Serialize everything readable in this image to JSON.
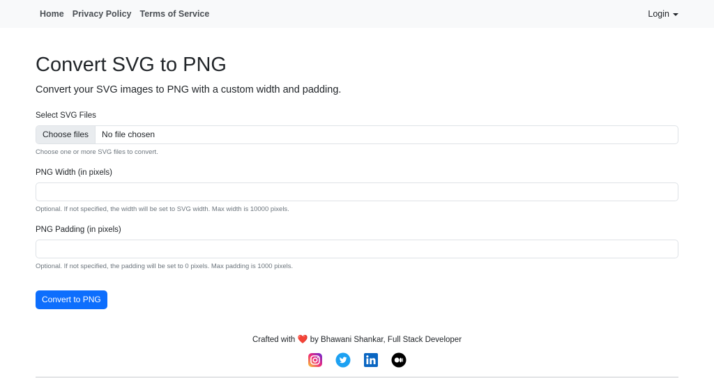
{
  "nav": {
    "links": [
      "Home",
      "Privacy Policy",
      "Terms of Service"
    ],
    "login": "Login"
  },
  "page": {
    "title": "Convert SVG to PNG",
    "lead": "Convert your SVG images to PNG with a custom width and padding."
  },
  "form": {
    "files_label": "Select SVG Files",
    "files_button": "Choose files",
    "files_status": "No file chosen",
    "files_help": "Choose one or more SVG files to convert.",
    "width_label": "PNG Width (in pixels)",
    "width_value": "",
    "width_help": "Optional. If not specified, the width will be set to SVG width. Max width is 10000 pixels.",
    "padding_label": "PNG Padding (in pixels)",
    "padding_value": "",
    "padding_help": "Optional. If not specified, the padding will be set to 0 pixels. Max padding is 1000 pixels.",
    "submit": "Convert to PNG"
  },
  "footer": {
    "credit_prefix": "Crafted with",
    "heart": "❤️",
    "credit_suffix": "by Bhawani Shankar, Full Stack Developer",
    "socials": [
      "instagram-icon",
      "twitter-icon",
      "linkedin-icon",
      "medium-icon"
    ]
  },
  "colors": {
    "primary": "#0d6efd",
    "navbar_bg": "#f8f9fa",
    "twitter": "#1da1f2",
    "linkedin": "#0a66c2"
  }
}
